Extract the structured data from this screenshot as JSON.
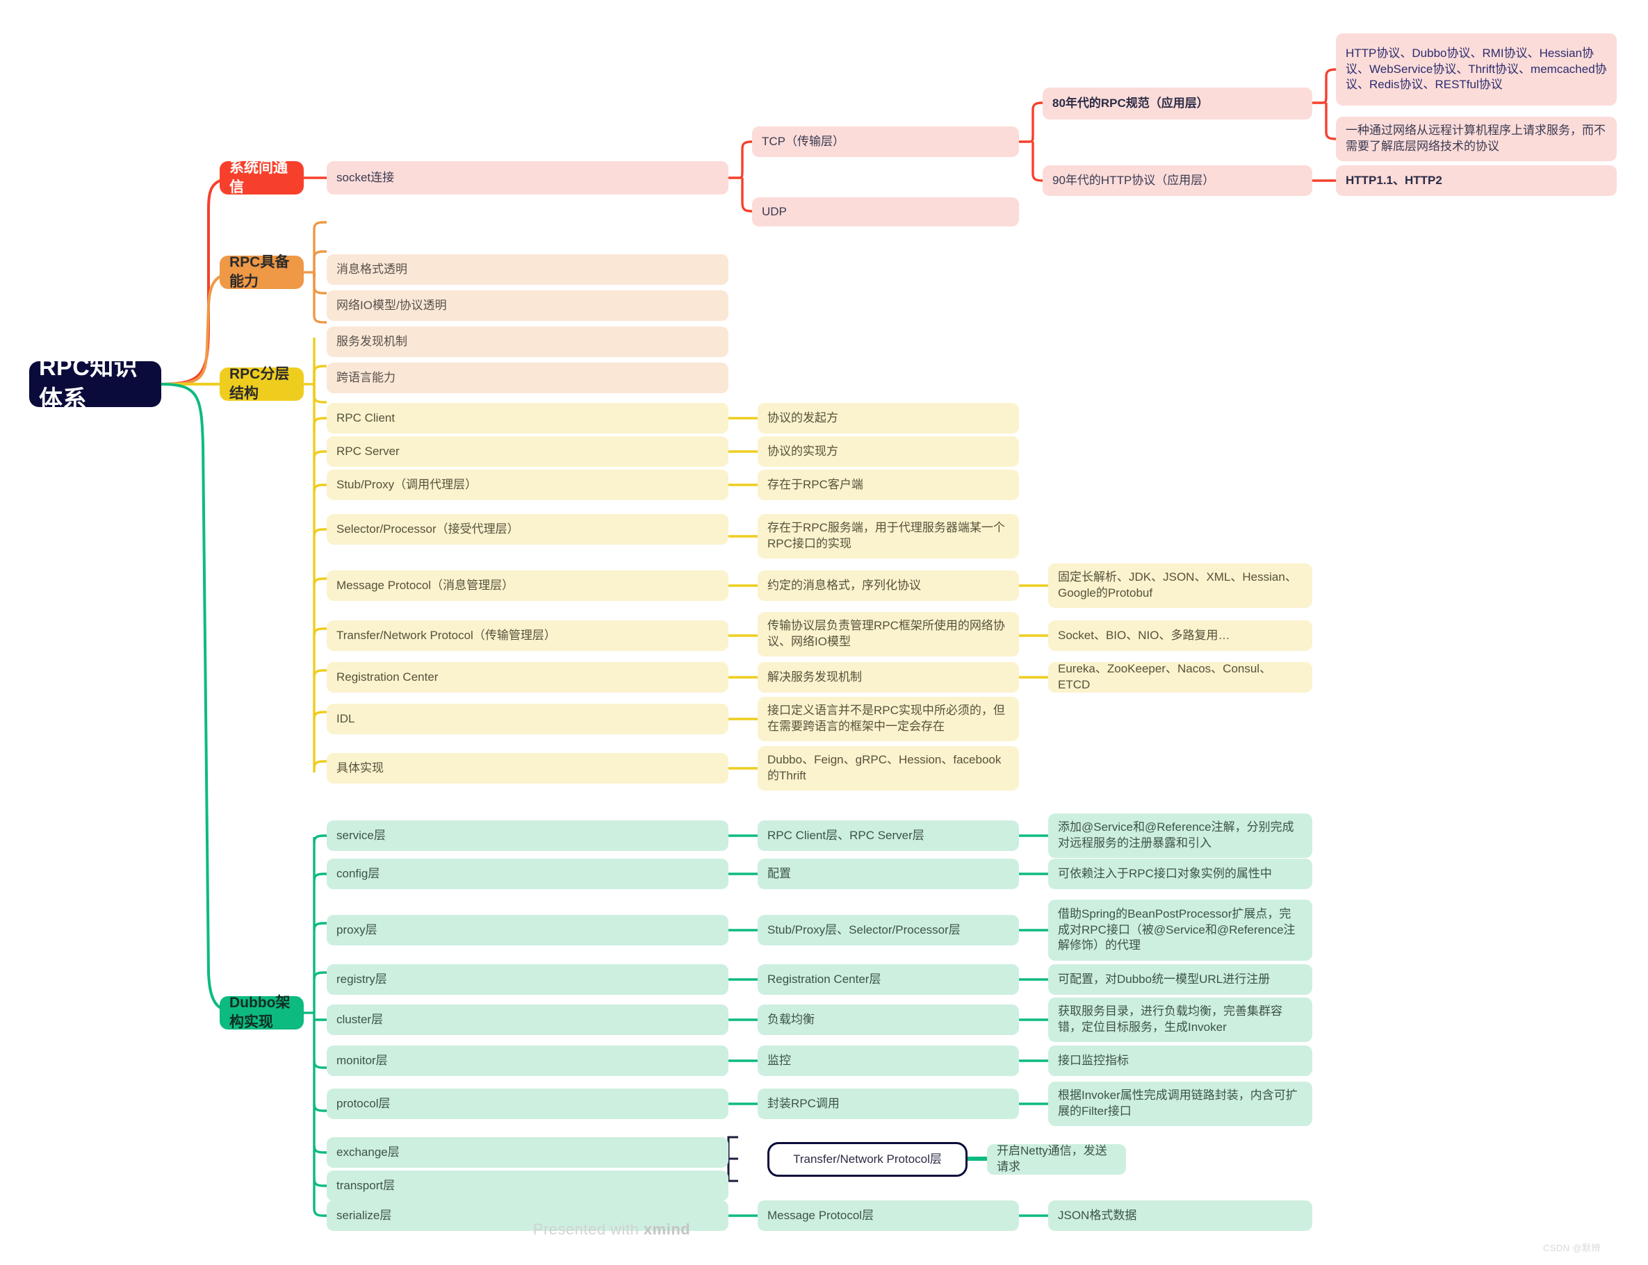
{
  "root": {
    "label": "RPC知识体系"
  },
  "colors": {
    "root_bg": "#0b0b3b",
    "red": "#f6402c",
    "orange": "#ef9845",
    "yellow": "#efcd1e",
    "green": "#0dba80",
    "red_leaf": "#fbdcd9",
    "orange_leaf": "#fbe7d6",
    "yellow_leaf": "#fbf3cd",
    "green_leaf": "#cdefdf"
  },
  "branches": [
    {
      "id": "comm",
      "label": "系统间通信",
      "color": "red"
    },
    {
      "id": "cap",
      "label": "RPC具备能力",
      "color": "orange"
    },
    {
      "id": "layers",
      "label": "RPC分层结构",
      "color": "yellow"
    },
    {
      "id": "dubbo",
      "label": "Dubbo架构实现",
      "color": "green"
    }
  ],
  "comm": {
    "socket": "socket连接",
    "tcp": "TCP（传输层）",
    "udp": "UDP",
    "rpc80": "80年代的RPC规范（应用层）",
    "http90": "90年代的HTTP协议（应用层）",
    "protocols": "HTTP协议、Dubbo协议、RMI协议、Hessian协议、WebService协议、Thrift协议、memcached协议、Redis协议、RESTful协议",
    "definition": "一种通过网络从远程计算机程序上请求服务，而不需要了解底层网络技术的协议",
    "http_versions": "HTTP1.1、HTTP2"
  },
  "capabilities": [
    "消息格式透明",
    "网络IO模型/协议透明",
    "服务发现机制",
    "跨语言能力"
  ],
  "layers": [
    {
      "name": "RPC Client",
      "desc": "协议的发起方",
      "detail": ""
    },
    {
      "name": "RPC Server",
      "desc": "协议的实现方",
      "detail": ""
    },
    {
      "name": "Stub/Proxy（调用代理层）",
      "desc": "存在于RPC客户端",
      "detail": ""
    },
    {
      "name": "Selector/Processor（接受代理层）",
      "desc": "存在于RPC服务端，用于代理服务器端某一个RPC接口的实现",
      "detail": ""
    },
    {
      "name": "Message Protocol（消息管理层）",
      "desc": "约定的消息格式，序列化协议",
      "detail": "固定长解析、JDK、JSON、XML、Hessian、Google的Protobuf"
    },
    {
      "name": "Transfer/Network Protocol（传输管理层）",
      "desc": "传输协议层负责管理RPC框架所使用的网络协议、网络IO模型",
      "detail": "Socket、BIO、NIO、多路复用…"
    },
    {
      "name": "Registration Center",
      "desc": "解决服务发现机制",
      "detail": "Eureka、ZooKeeper、Nacos、Consul、ETCD"
    },
    {
      "name": "IDL",
      "desc": "接口定义语言并不是RPC实现中所必须的，但在需要跨语言的框架中一定会存在",
      "detail": ""
    },
    {
      "name": "具体实现",
      "desc": "Dubbo、Feign、gRPC、Hession、facebook的Thrift",
      "detail": ""
    }
  ],
  "dubbo": [
    {
      "name": "service层",
      "map": "RPC Client层、RPC Server层",
      "desc": "添加@Service和@Reference注解，分别完成对远程服务的注册暴露和引入"
    },
    {
      "name": "config层",
      "map": "配置",
      "desc": "可依赖注入于RPC接口对象实例的属性中"
    },
    {
      "name": "proxy层",
      "map": "Stub/Proxy层、Selector/Processor层",
      "desc": "借助Spring的BeanPostProcessor扩展点，完成对RPC接口（被@Service和@Reference注解修饰）的代理"
    },
    {
      "name": "registry层",
      "map": "Registration Center层",
      "desc": "可配置，对Dubbo统一模型URL进行注册"
    },
    {
      "name": "cluster层",
      "map": "负载均衡",
      "desc": "获取服务目录，进行负载均衡，完善集群容错，定位目标服务，生成Invoker"
    },
    {
      "name": "monitor层",
      "map": "监控",
      "desc": "接口监控指标"
    },
    {
      "name": "protocol层",
      "map": "封装RPC调用",
      "desc": "根据Invoker属性完成调用链路封装，内含可扩展的Filter接口"
    }
  ],
  "dubbo_grouped": {
    "members": [
      "exchange层",
      "transport层"
    ],
    "map": "Transfer/Network Protocol层",
    "desc": "开启Netty通信，发送请求"
  },
  "dubbo_tail": {
    "name": "serialize层",
    "map": "Message Protocol层",
    "desc": "JSON格式数据"
  },
  "watermarks": {
    "xmind_prefix": "Presented with ",
    "xmind_brand": "xmind",
    "csdn": "CSDN @默辨"
  }
}
